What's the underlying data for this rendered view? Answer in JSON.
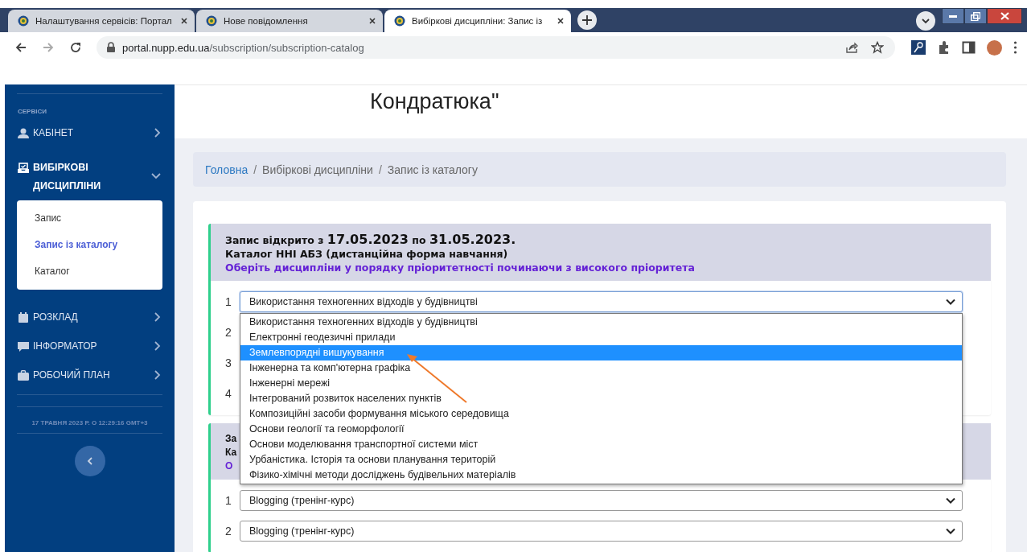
{
  "browser": {
    "tabs": [
      {
        "title": "Налаштування сервісів: Портал",
        "selected": false
      },
      {
        "title": "Нове повідомлення",
        "selected": false
      },
      {
        "title": "Вибіркові дисципліни: Запис із",
        "selected": true
      }
    ],
    "url_host": "portal.nupp.edu.ua",
    "url_path": "/subscription/subscription-catalog"
  },
  "header": {
    "title": "Кондратюка\""
  },
  "sidebar": {
    "section_label": "СЕРВІСИ",
    "items": [
      {
        "label": "КАБІНЕТ",
        "expanded": false
      },
      {
        "label": "ВИБІРКОВІ ДИСЦИПЛІНИ",
        "expanded": true,
        "children": [
          {
            "label": "Запис",
            "selected": false
          },
          {
            "label": "Запис із каталогу",
            "selected": true
          },
          {
            "label": "Каталог",
            "selected": false
          }
        ]
      },
      {
        "label": "РОЗКЛАД",
        "expanded": false
      },
      {
        "label": "ІНФОРМАТОР",
        "expanded": false
      },
      {
        "label": "РОБОЧИЙ ПЛАН",
        "expanded": false
      }
    ],
    "datetime": "17 ТРАВНЯ 2023 Р. О 12:29:16 GMT+3"
  },
  "breadcrumb": [
    {
      "label": "Головна",
      "kind": "link"
    },
    {
      "separator": "/",
      "label": "Вибіркові дисципліни",
      "kind": "text"
    },
    {
      "separator": "/",
      "label": "Запис із каталогу",
      "kind": "text"
    }
  ],
  "sections": [
    {
      "label_from": "Запис відкрито з",
      "date_from": "17.05.2023",
      "label_to": "по",
      "date_to": "31.05.2023.",
      "catalog": "Каталог ННІ АБЗ (дистанційна форма навчання)",
      "instruction": "Оберіть дисципліни у порядку пріоритетності починаючи з високого пріоритета",
      "rows": [
        {
          "number": "1",
          "value": "Використання техногенних відходів у будівництві",
          "expanded": true,
          "options": [
            {
              "label": "Використання техногенних відходів у будівництві",
              "highlighted": false
            },
            {
              "label": "Електронні геодезичні прилади",
              "highlighted": false
            },
            {
              "label": "Землевпорядні вишукування",
              "highlighted": true
            },
            {
              "label": "Інженерна та комп'ютерна графіка",
              "highlighted": false
            },
            {
              "label": "Інженерні мережі",
              "highlighted": false
            },
            {
              "label": "Інтегрований розвиток населених пунктів",
              "highlighted": false
            },
            {
              "label": "Композиційні засоби формування міського середовища",
              "highlighted": false
            },
            {
              "label": "Основи геології та геоморфології",
              "highlighted": false
            },
            {
              "label": "Основи моделювання транспортної системи міст",
              "highlighted": false
            },
            {
              "label": "Урбаністика. Історія та основи планування територій",
              "highlighted": false
            },
            {
              "label": "Фізико-хімічні методи досліджень будівельних матеріалів",
              "highlighted": false
            }
          ]
        },
        {
          "number": "2"
        },
        {
          "number": "3"
        },
        {
          "number": "4"
        }
      ]
    },
    {
      "label_from": "За",
      "catalog": "Ка",
      "instruction": "О",
      "rows": [
        {
          "number": "1",
          "value": "Blogging (тренінг-курс)",
          "expanded": false
        },
        {
          "number": "2",
          "value": "Blogging (тренінг-курс)",
          "expanded": false
        }
      ]
    }
  ]
}
